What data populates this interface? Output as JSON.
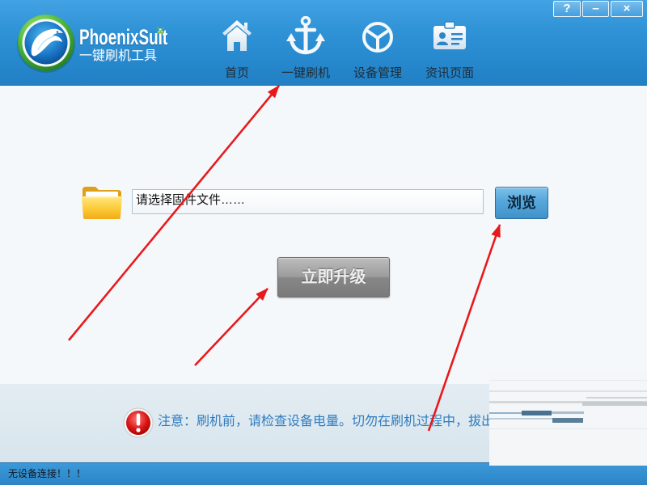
{
  "app": {
    "name": "PhoenixSuit",
    "subtitle": "一键刷机工具",
    "logo_icon": "phoenix-logo-icon"
  },
  "window_controls": {
    "help": "?",
    "minimize": "–",
    "close": "×"
  },
  "nav": {
    "items": [
      {
        "label": "首页",
        "icon": "home-icon"
      },
      {
        "label": "一键刷机",
        "icon": "anchor-icon"
      },
      {
        "label": "设备管理",
        "icon": "cube-icon"
      },
      {
        "label": "资讯页面",
        "icon": "id-card-icon"
      }
    ]
  },
  "main": {
    "firmware_input": {
      "value": "请选择固件文件……",
      "icon": "folder-icon"
    },
    "browse_button": {
      "label": "浏览"
    },
    "upgrade_button": {
      "label": "立即升级",
      "disabled": true
    }
  },
  "notice": {
    "icon": "warning-icon",
    "text": "注意：刷机前，请检查设备电量。切勿在刷机过程中，拔出"
  },
  "status_bar": {
    "text": "无设备连接！！！"
  },
  "colors": {
    "header": "#2e8fd4",
    "status_bar": "#2f8acb",
    "notice_text": "#2f7cbf",
    "browse_button": "#4f9fd4",
    "upgrade_button_disabled": "#8c8c8c",
    "annotation_arrows": "#e8191c"
  }
}
